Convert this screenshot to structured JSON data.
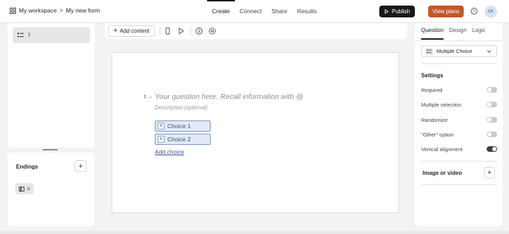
{
  "header": {
    "workspace": "My workspace",
    "separator": ">",
    "form_name": "My new form",
    "tabs": [
      {
        "label": "Create",
        "active": true
      },
      {
        "label": "Connect",
        "active": false
      },
      {
        "label": "Share",
        "active": false
      },
      {
        "label": "Results",
        "active": false
      }
    ],
    "publish_label": "Publish",
    "view_plans_label": "View plans",
    "avatar_initials": "CK",
    "colors": {
      "publish_bg": "#191919",
      "view_plans_bg": "#c1582a",
      "avatar_bg": "#d6e4f5"
    }
  },
  "left_panel": {
    "question_item": {
      "number": "1",
      "icon": "multiple-choice-icon"
    }
  },
  "endings": {
    "title": "Endings",
    "add_icon": "plus-icon",
    "item": {
      "icon": "ending-screen-icon",
      "label": "A"
    }
  },
  "toolbar": {
    "add_content_label": "Add content",
    "icons": [
      "mobile-preview-icon",
      "play-icon",
      "info-icon",
      "settings-icon"
    ]
  },
  "question": {
    "number": "1",
    "arrow": "→",
    "placeholder": "Your question here. Recall information with @",
    "description_placeholder": "Description (optional)",
    "choices": [
      {
        "key": "A",
        "label": "Choice 1"
      },
      {
        "key": "B",
        "label": "Choice 2"
      }
    ],
    "add_choice_label": "Add choice"
  },
  "right_panel": {
    "tabs": [
      {
        "label": "Question",
        "active": true
      },
      {
        "label": "Design",
        "active": false
      },
      {
        "label": "Logic",
        "active": false
      }
    ],
    "question_type": "Multiple Choice",
    "settings_title": "Settings",
    "settings": [
      {
        "label": "Required",
        "on": false
      },
      {
        "label": "Multiple selection",
        "on": false
      },
      {
        "label": "Randomize",
        "on": false
      },
      {
        "label": "\"Other\" option",
        "on": false
      },
      {
        "label": "Vertical alignment",
        "on": true
      }
    ],
    "media_title": "Image or video",
    "media_add_icon": "plus-icon"
  }
}
